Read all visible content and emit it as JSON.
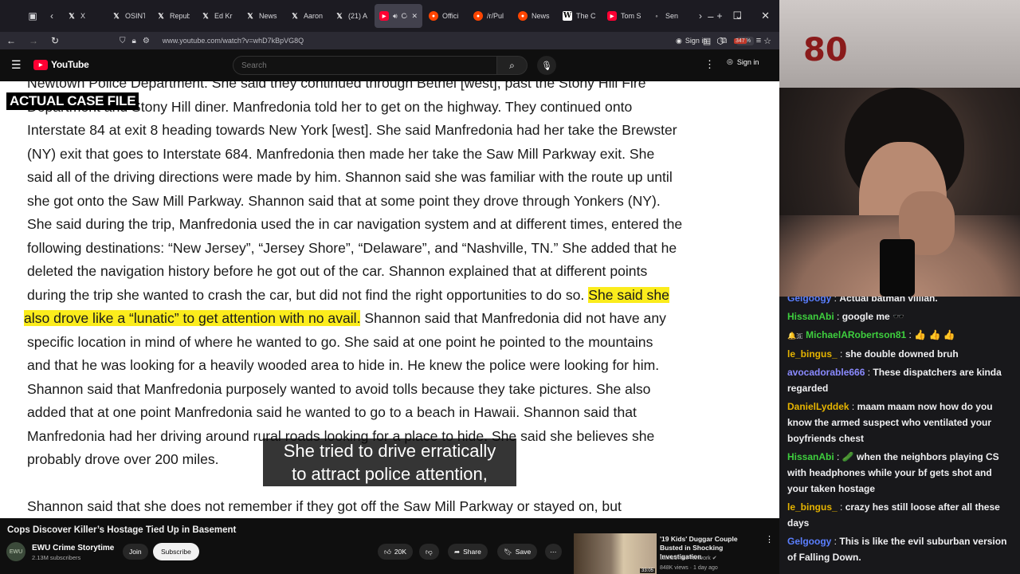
{
  "browser": {
    "tabs": [
      {
        "icon": "x-icon",
        "label": "X"
      },
      {
        "icon": "x-icon",
        "label": "OSINT"
      },
      {
        "icon": "x-icon",
        "label": "Repub"
      },
      {
        "icon": "x-icon",
        "label": "Ed Kr"
      },
      {
        "icon": "x-icon",
        "label": "News"
      },
      {
        "icon": "x-icon",
        "label": "Aaron"
      },
      {
        "icon": "x-icon",
        "label": "(21) A"
      },
      {
        "icon": "youtube-icon",
        "label": "Cop",
        "active": true
      },
      {
        "icon": "reddit-icon",
        "label": "Offici"
      },
      {
        "icon": "reddit-icon",
        "label": "/r/Pul"
      },
      {
        "icon": "reddit-icon",
        "label": "News"
      },
      {
        "icon": "wikipedia-icon",
        "label": "The C"
      },
      {
        "icon": "youtube-icon",
        "label": "Tom S"
      },
      {
        "icon": "generic-icon",
        "label": "Sen"
      }
    ],
    "url": "www.youtube.com/watch?v=whD7kBpVG8Q",
    "zoom": "90%",
    "sign_in": "Sign in",
    "extension_badge": "347"
  },
  "youtube": {
    "logo_text": "YouTube",
    "search_placeholder": "Search",
    "sign_in": "Sign in"
  },
  "video": {
    "overlay_tag": "ACTUAL CASE FILE",
    "document_lines": [
      {
        "text": "Newtown Police Department.  She said they continued through Bethel [west], past the Stony Hill Fire"
      },
      {
        "text": "Department and Stony Hill diner.  Manfredonia told her to get on the highway.  They continued onto"
      },
      {
        "text": "Interstate 84 at exit 8 heading towards New York [west].  She said Manfredonia had her take the Brewster"
      },
      {
        "text": "(NY) exit that goes to Interstate 684.  Manfredonia then made her take the Saw Mill Parkway exit.  She"
      },
      {
        "text": "said all of the driving directions were made by him.  Shannon said she was familiar with the route up until"
      },
      {
        "text": "she got onto the Saw Mill Parkway.  Shannon said that at some point they drove through Yonkers (NY)."
      },
      {
        "text": "She said during the trip, Manfredonia used the in car navigation system and at different times, entered the"
      },
      {
        "text": "following destinations: “New Jersey”, “Jersey Shore”, “Delaware”, and “Nashville, TN.”  She added that he"
      },
      {
        "text": "deleted the navigation history before he got out of the car.  Shannon explained that at different points"
      },
      {
        "text": "during the trip she wanted to crash the car, but did not find the right opportunities to do so.  ",
        "highlight": "She said she"
      },
      {
        "highlight": "also drove like a “lunatic” to get attention with no avail.",
        "text": "  Shannon said that Manfredonia did not have any"
      },
      {
        "text": "specific location in mind of where he wanted to go.  She said at one point he pointed to the mountains"
      },
      {
        "text": "and that he was looking for a heavily wooded area to hide in.  He knew the police were looking for him."
      },
      {
        "text": "Shannon said that Manfredonia purposely wanted to avoid tolls because they take pictures.  She also"
      },
      {
        "text": "added that at one point Manfredonia said he wanted to go to a beach in Hawaii.  Shannon said that"
      },
      {
        "text": "Manfredonia had her driving around rural roads looking for a place to hide.  She said she believes she"
      },
      {
        "text": "probably drove over 200 miles."
      },
      {
        "text": ""
      },
      {
        "text": "Shannon said that she does not remember if they got off the Saw Mill Parkway or stayed on, but"
      }
    ],
    "caption_line1": "She tried to drive erratically",
    "caption_line2": "to attract police attention,",
    "title": "Cops Discover Killer’s Hostage Tied Up in Basement",
    "channel": {
      "name": "EWU Crime Storytime",
      "subscribers": "2.13M subscribers",
      "avatar_text": "EWU"
    },
    "join_label": "Join",
    "subscribe_label": "Subscribe",
    "like_count": "20K",
    "share_label": "Share",
    "save_label": "Save"
  },
  "recommendation": {
    "title": "'19 Kids' Duggar Couple Busted in Shocking Investigation",
    "channel": "Law&Crime Network",
    "meta": "848K views · 1 day ago",
    "duration": "33:05"
  },
  "webcam": {
    "background_sign": "80"
  },
  "chat": [
    {
      "user": "Gelgoogy",
      "color": "#5b7fff",
      "text": "Actual batman villian.",
      "cut": true
    },
    {
      "user": "HissanAbi",
      "color": "#3ecf3e",
      "text": "google me 🕶️"
    },
    {
      "user": "MichaelARobertson81",
      "color": "#3ecf3e",
      "badges": "🔔🇸",
      "text": "👍 👍 👍"
    },
    {
      "user": "le_bingus_",
      "color": "#e6b400",
      "text": "she double downed bruh"
    },
    {
      "user": "avocadorable666",
      "color": "#8a8aff",
      "text": "These dispatchers are kinda regarded"
    },
    {
      "user": "DanielLyddek",
      "color": "#e6b400",
      "text": "maam maam now how do you know the armed suspect who ventilated your boyfriends chest"
    },
    {
      "user": "HissanAbi",
      "color": "#3ecf3e",
      "text": "🥒 when the neighbors playing CS with headphones while your bf gets shot and your taken hostage"
    },
    {
      "user": "le_bingus_",
      "color": "#e6b400",
      "text": "crazy hes still loose after all these days"
    },
    {
      "user": "Gelgoogy",
      "color": "#5b7fff",
      "text": "This is like the evil suburban version of Falling Down."
    }
  ],
  "colors": {
    "highlight": "#fbec1c",
    "youtube_red": "#ff0033",
    "chat_bg": "#18181b"
  }
}
